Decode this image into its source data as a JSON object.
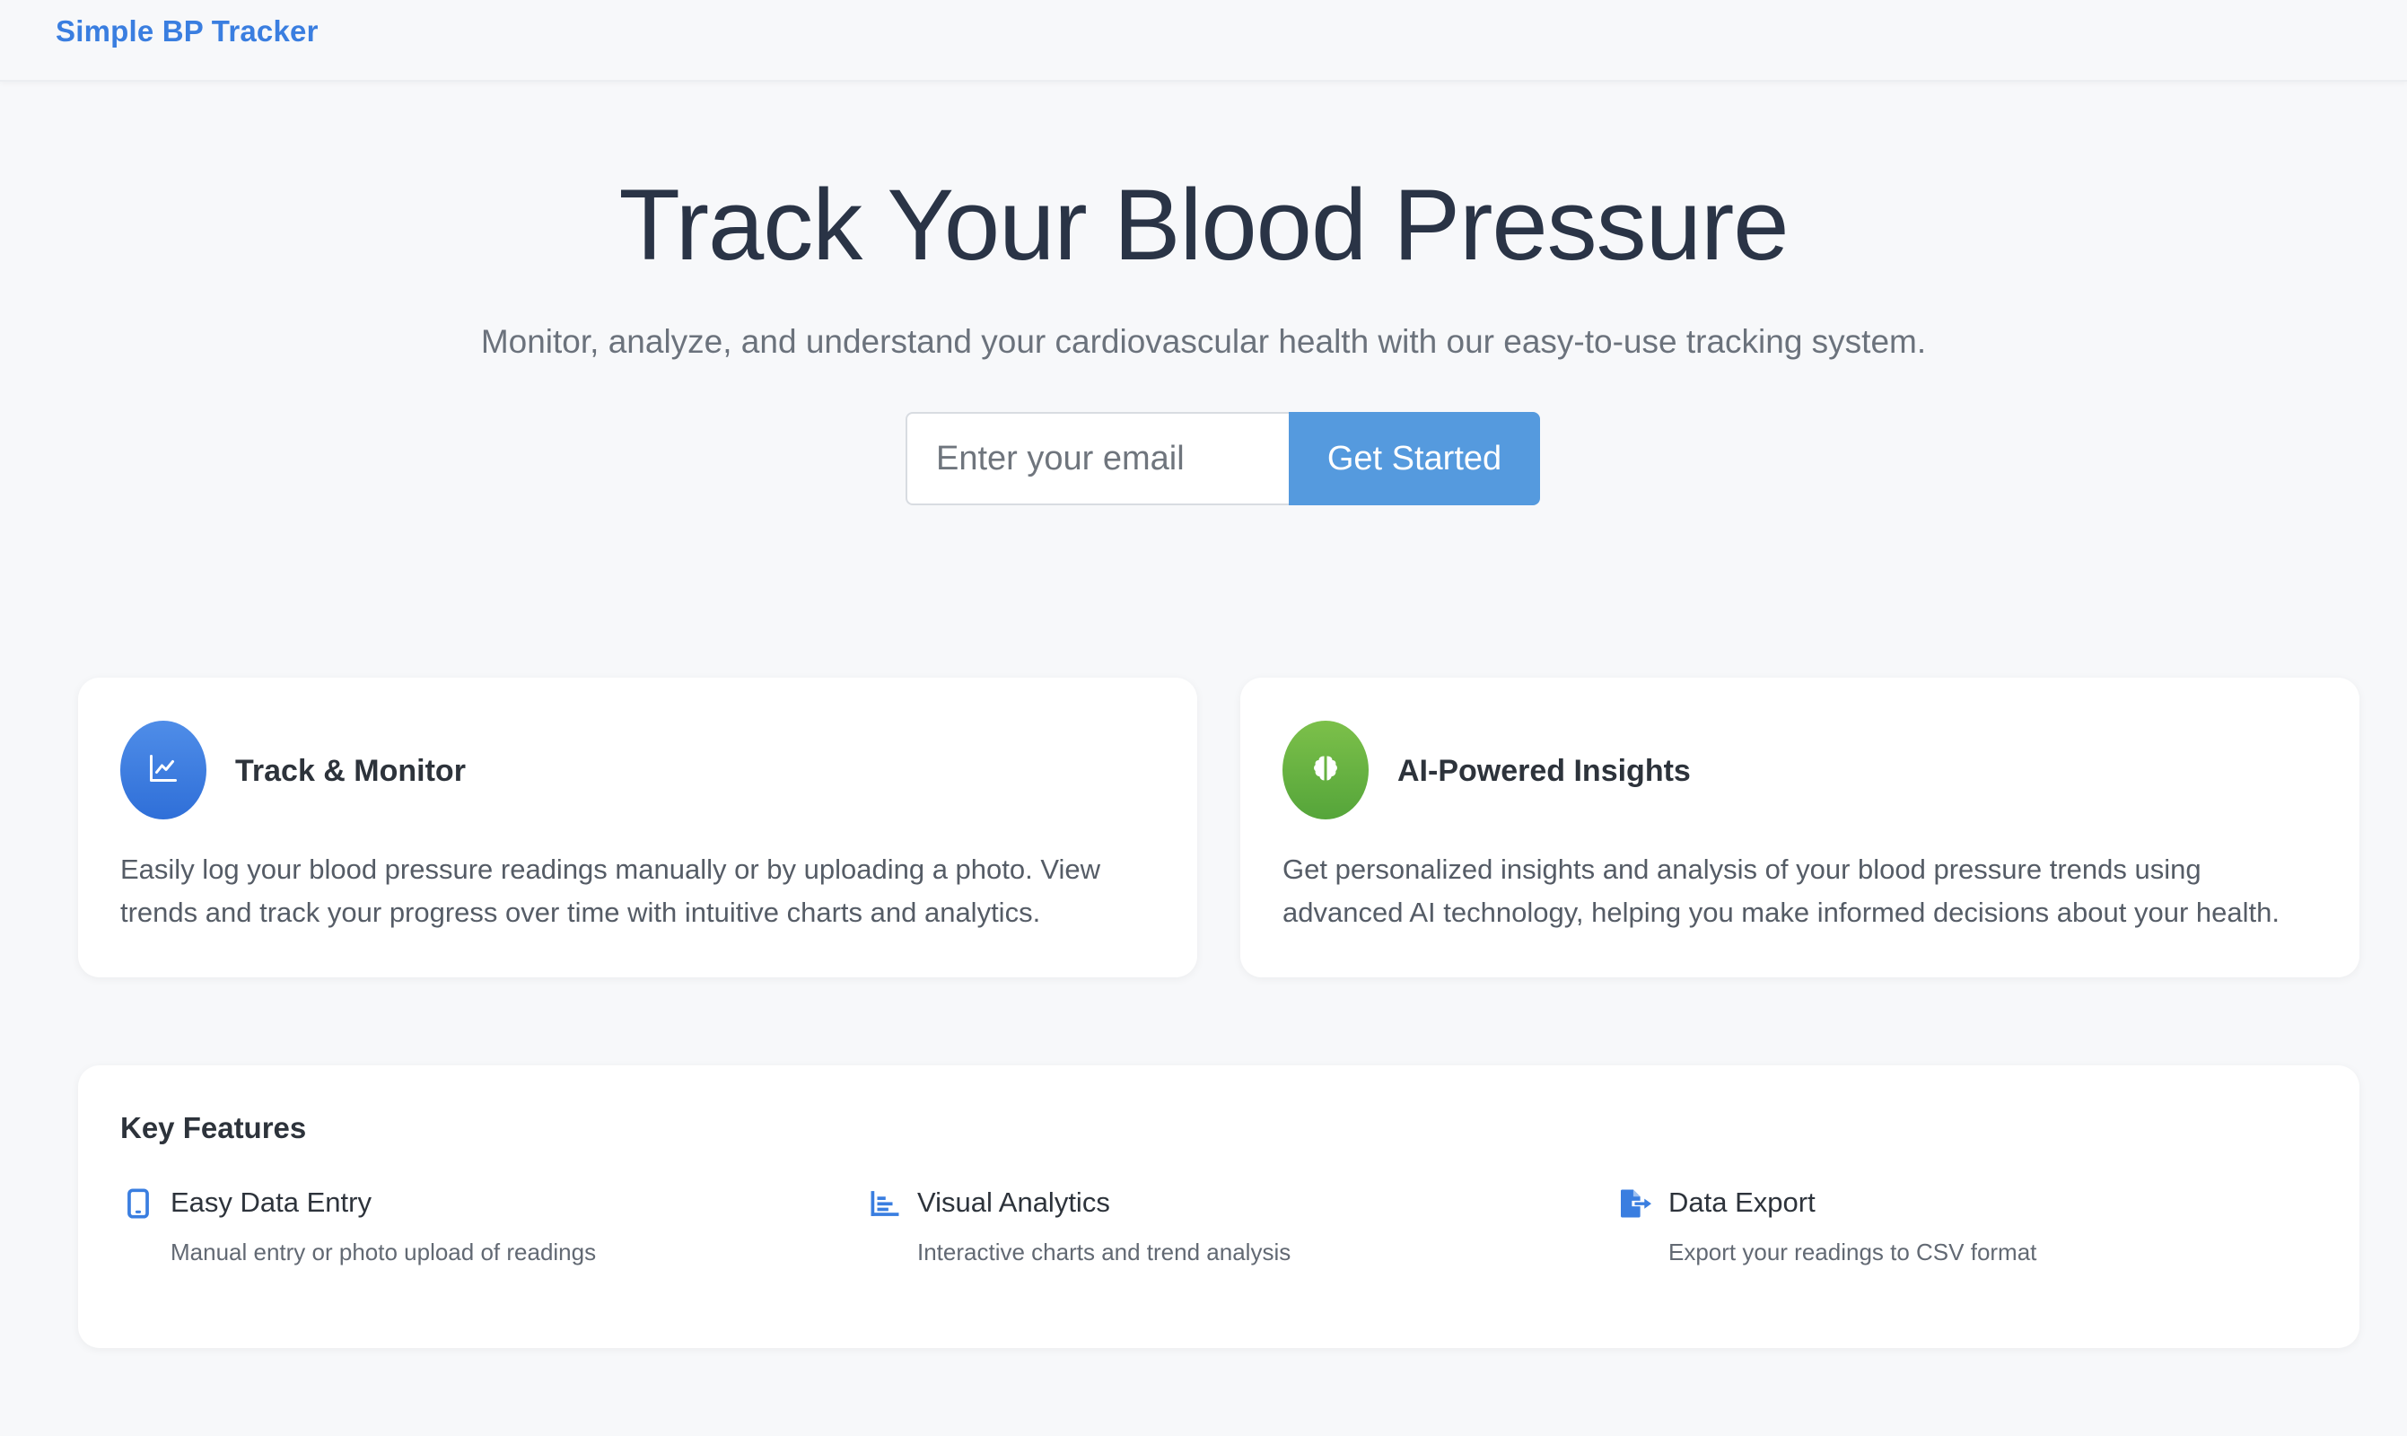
{
  "header": {
    "brand": "Simple BP Tracker"
  },
  "hero": {
    "title": "Track Your Blood Pressure",
    "subtitle": "Monitor, analyze, and understand your cardiovascular health with our easy-to-use tracking system.",
    "email_placeholder": "Enter your email",
    "email_value": "",
    "cta_label": "Get Started"
  },
  "cards": [
    {
      "icon": "chart-line-icon",
      "title": "Track & Monitor",
      "description": "Easily log your blood pressure readings manually or by uploading a photo. View trends and track your progress over time with intuitive charts and analytics.",
      "color": "#3a7ee0"
    },
    {
      "icon": "brain-icon",
      "title": "AI-Powered Insights",
      "description": "Get personalized insights and analysis of your blood pressure trends using advanced AI technology, helping you make informed decisions about your health.",
      "color": "#62b03f"
    }
  ],
  "key_features": {
    "heading": "Key Features",
    "items": [
      {
        "icon": "mobile-phone-icon",
        "title": "Easy Data Entry",
        "description": "Manual entry or photo upload of readings"
      },
      {
        "icon": "bar-chart-icon",
        "title": "Visual Analytics",
        "description": "Interactive charts and trend analysis"
      },
      {
        "icon": "file-export-icon",
        "title": "Data Export",
        "description": "Export your readings to CSV format"
      }
    ]
  },
  "colors": {
    "accent": "#3a7ee0",
    "button": "#559ade",
    "background": "#f7f8fa",
    "green": "#62b03f"
  }
}
